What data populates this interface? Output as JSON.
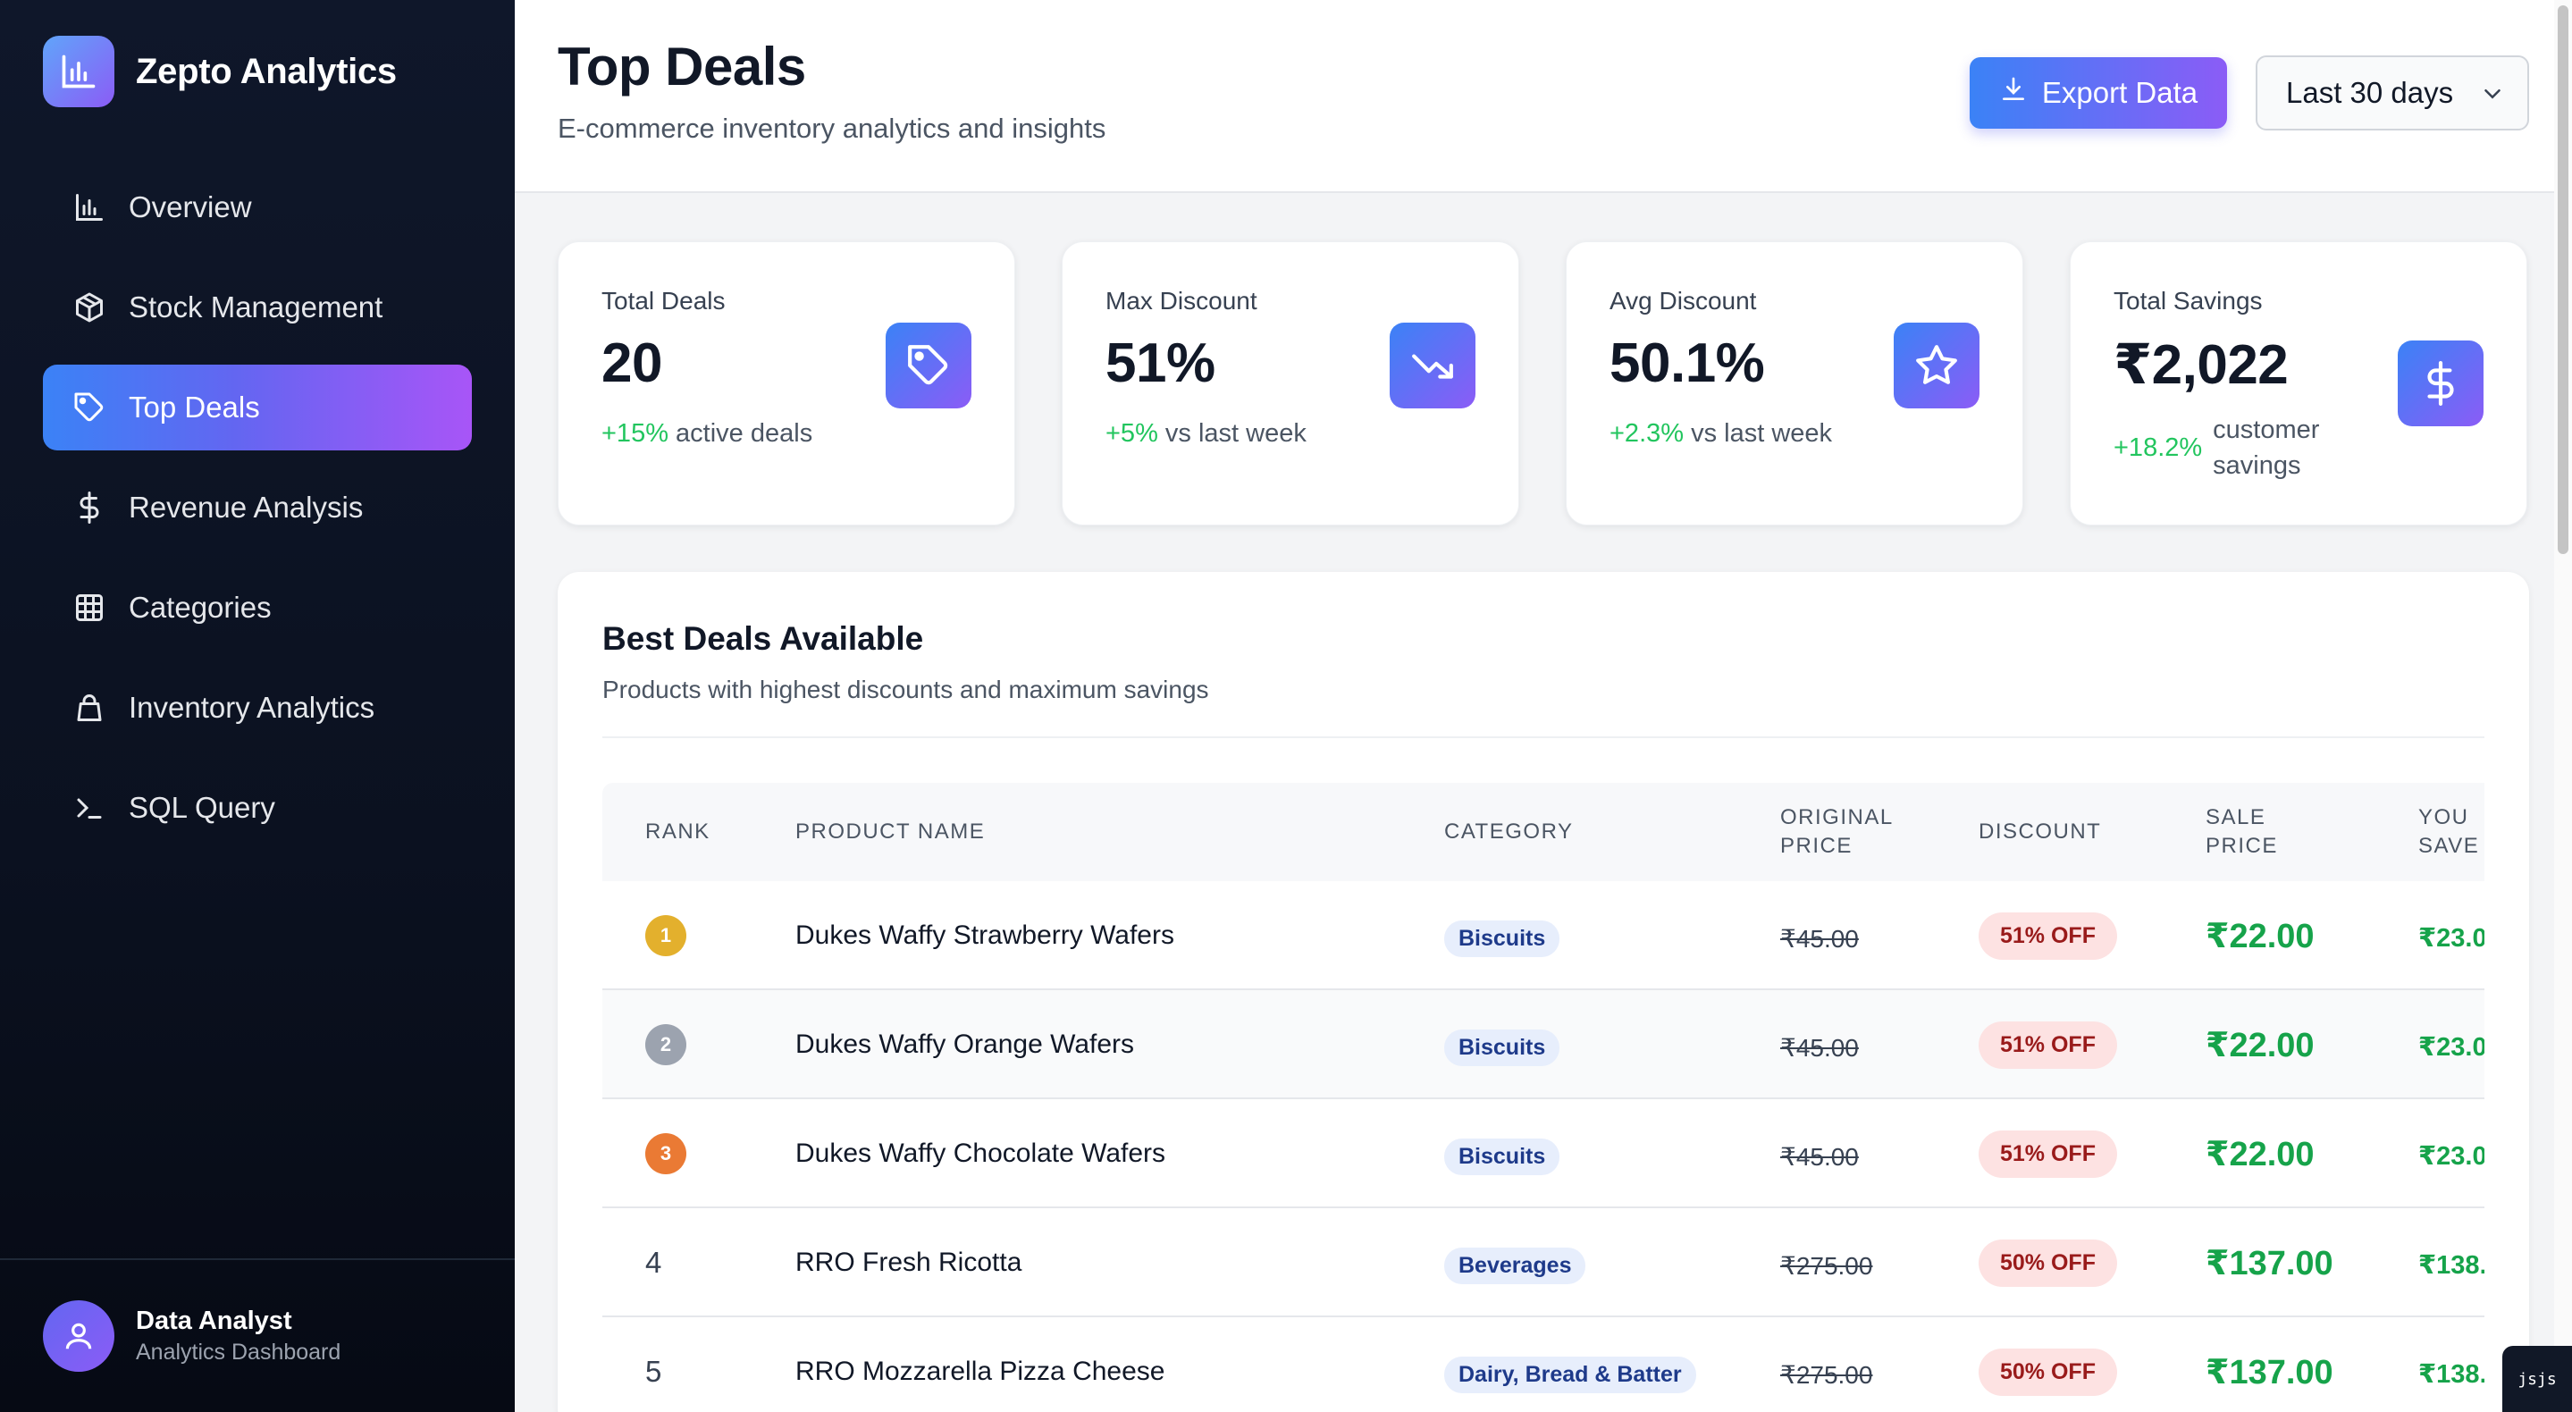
{
  "app": {
    "name": "Zepto Analytics"
  },
  "sidebar": {
    "items": [
      {
        "label": "Overview",
        "icon": "bar-chart-icon",
        "active": false
      },
      {
        "label": "Stock Management",
        "icon": "package-icon",
        "active": false
      },
      {
        "label": "Top Deals",
        "icon": "tag-icon",
        "active": true
      },
      {
        "label": "Revenue Analysis",
        "icon": "dollar-icon",
        "active": false
      },
      {
        "label": "Categories",
        "icon": "grid-icon",
        "active": false
      },
      {
        "label": "Inventory Analytics",
        "icon": "shopping-bag-icon",
        "active": false
      },
      {
        "label": "SQL Query",
        "icon": "terminal-icon",
        "active": false
      }
    ],
    "user": {
      "name": "Data Analyst",
      "role": "Analytics Dashboard"
    }
  },
  "header": {
    "title": "Top Deals",
    "subtitle": "E-commerce inventory analytics and insights",
    "export_label": "Export Data",
    "period": "Last 30 days"
  },
  "stats": [
    {
      "label": "Total Deals",
      "value": "20",
      "change": "+15%",
      "change_text": "active deals",
      "icon": "tag-icon"
    },
    {
      "label": "Max Discount",
      "value": "51%",
      "change": "+5%",
      "change_text": "vs last week",
      "icon": "trending-down-icon"
    },
    {
      "label": "Avg Discount",
      "value": "50.1%",
      "change": "+2.3%",
      "change_text": "vs last week",
      "icon": "star-icon"
    },
    {
      "label": "Total Savings",
      "value": "₹2,022",
      "change": "+18.2%",
      "change_text": "customer savings",
      "icon": "dollar-icon"
    }
  ],
  "deals": {
    "title": "Best Deals Available",
    "subtitle": "Products with highest discounts and maximum savings",
    "columns": [
      "RANK",
      "PRODUCT NAME",
      "CATEGORY",
      "ORIGINAL PRICE",
      "DISCOUNT",
      "SALE PRICE",
      "YOU SAVE"
    ],
    "rows": [
      {
        "rank": "1",
        "product": "Dukes Waffy Strawberry Wafers",
        "category": "Biscuits",
        "original": "₹45.00",
        "discount": "51% OFF",
        "sale": "₹22.00",
        "save": "₹23.0"
      },
      {
        "rank": "2",
        "product": "Dukes Waffy Orange Wafers",
        "category": "Biscuits",
        "original": "₹45.00",
        "discount": "51% OFF",
        "sale": "₹22.00",
        "save": "₹23.0"
      },
      {
        "rank": "3",
        "product": "Dukes Waffy Chocolate Wafers",
        "category": "Biscuits",
        "original": "₹45.00",
        "discount": "51% OFF",
        "sale": "₹22.00",
        "save": "₹23.0"
      },
      {
        "rank": "4",
        "product": "RRO Fresh Ricotta",
        "category": "Beverages",
        "original": "₹275.00",
        "discount": "50% OFF",
        "sale": "₹137.00",
        "save": "₹138."
      },
      {
        "rank": "5",
        "product": "RRO Mozzarella Pizza Cheese",
        "category": "Dairy, Bread & Batter",
        "original": "₹275.00",
        "discount": "50% OFF",
        "sale": "₹137.00",
        "save": "₹138."
      }
    ],
    "badge_colors": [
      "#e3b02d",
      "#9ca3af",
      "#ea7a34"
    ]
  },
  "colors": {
    "accent_start": "#3b82f6",
    "accent_end": "#8b5cf6",
    "positive": "#16a34a",
    "discount": "#991b1b"
  },
  "dev_badge": "jsjs"
}
